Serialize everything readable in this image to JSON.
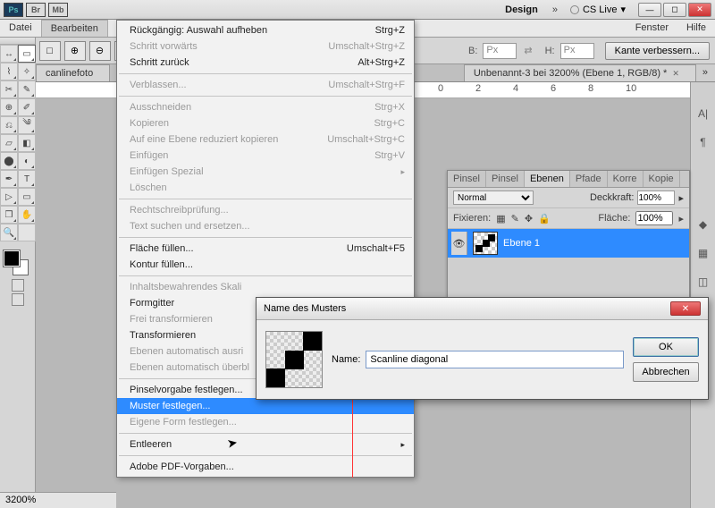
{
  "app": {
    "ps": "Ps",
    "br": "Br",
    "mb": "Mb"
  },
  "titleTabs": {
    "design": "Design",
    "cslive": "CS Live"
  },
  "menu": {
    "datei": "Datei",
    "bearbeiten": "Bearbeiten",
    "fenster": "Fenster",
    "hilfe": "Hilfe"
  },
  "opt": {
    "b": "B:",
    "h": "H:",
    "px": "Px",
    "refine": "Kante verbessern..."
  },
  "docTabs": {
    "left": "canlinefoto",
    "right": "Unbenannt-3 bei 3200% (Ebene 1, RGB/8) *"
  },
  "ruler": {
    "t0": "0",
    "t2": "2",
    "t4": "4",
    "t6": "6",
    "t8": "8",
    "t10": "10"
  },
  "zoom": "3200%",
  "dropdown": {
    "undo": "Rückgängig: Auswahl aufheben",
    "undo_sc": "Strg+Z",
    "fwd": "Schritt vorwärts",
    "fwd_sc": "Umschalt+Strg+Z",
    "back": "Schritt zurück",
    "back_sc": "Alt+Strg+Z",
    "fade": "Verblassen...",
    "fade_sc": "Umschalt+Strg+F",
    "cut": "Ausschneiden",
    "cut_sc": "Strg+X",
    "copy": "Kopieren",
    "copy_sc": "Strg+C",
    "copylayer": "Auf eine Ebene reduziert kopieren",
    "copylayer_sc": "Umschalt+Strg+C",
    "paste": "Einfügen",
    "paste_sc": "Strg+V",
    "pastespecial": "Einfügen Spezial",
    "delete": "Löschen",
    "spell": "Rechtschreibprüfung...",
    "findrep": "Text suchen und ersetzen...",
    "fill": "Fläche füllen...",
    "fill_sc": "Umschalt+F5",
    "stroke": "Kontur füllen...",
    "contentaware": "Inhaltsbewahrendes Skali",
    "puppet": "Formgitter",
    "freetrans": "Frei transformieren",
    "transform": "Transformieren",
    "autoalign": "Ebenen automatisch ausri",
    "autoblend": "Ebenen automatisch überbl",
    "defbrush": "Pinselvorgabe festlegen...",
    "defpattern": "Muster festlegen...",
    "defshape": "Eigene Form festlegen...",
    "purge": "Entleeren",
    "pdfpresets": "Adobe PDF-Vorgaben..."
  },
  "layers": {
    "tabs": {
      "pinsel1": "Pinsel",
      "pinsel2": "Pinsel",
      "ebenen": "Ebenen",
      "pfade": "Pfade",
      "korre": "Korre",
      "kopie": "Kopie"
    },
    "mode": "Normal",
    "opacity_l": "Deckkraft:",
    "opacity_v": "100%",
    "lock": "Fixieren:",
    "fill_l": "Fläche:",
    "fill_v": "100%",
    "layer1": "Ebene 1"
  },
  "dialog": {
    "title": "Name des Musters",
    "name_l": "Name:",
    "name_v": "Scanline diagonal",
    "ok": "OK",
    "cancel": "Abbrechen"
  }
}
